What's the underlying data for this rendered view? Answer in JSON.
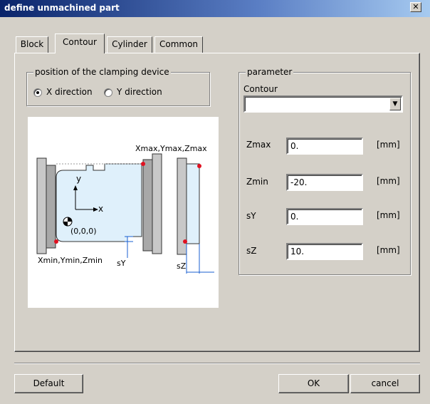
{
  "window": {
    "title": "define unmachined part",
    "close_glyph": "✕"
  },
  "tabs": [
    {
      "label": "Block"
    },
    {
      "label": "Contour"
    },
    {
      "label": "Cylinder"
    },
    {
      "label": "Common"
    }
  ],
  "clamping": {
    "legend": "position of the clamping device",
    "options": [
      {
        "label": "X direction",
        "checked": true
      },
      {
        "label": "Y direction",
        "checked": false
      }
    ]
  },
  "diagram": {
    "label_max": "Xmax,Ymax,Zmax",
    "label_min": "Xmin,Ymin,Zmin",
    "label_origin": "(0,0,0)",
    "axis_x": "x",
    "axis_y": "y",
    "label_sy": "sY",
    "label_sz": "sZ"
  },
  "parameter": {
    "legend": "parameter",
    "contour_label": "Contour",
    "contour_value": "",
    "fields": [
      {
        "label": "Zmax",
        "value": "0.",
        "unit": "[mm]"
      },
      {
        "label": "Zmin",
        "value": "-20.",
        "unit": "[mm]"
      },
      {
        "label": "sY",
        "value": "0.",
        "unit": "[mm]"
      },
      {
        "label": "sZ",
        "value": "10.",
        "unit": "[mm]"
      }
    ]
  },
  "buttons": {
    "default": "Default",
    "ok": "OK",
    "cancel": "cancel"
  }
}
